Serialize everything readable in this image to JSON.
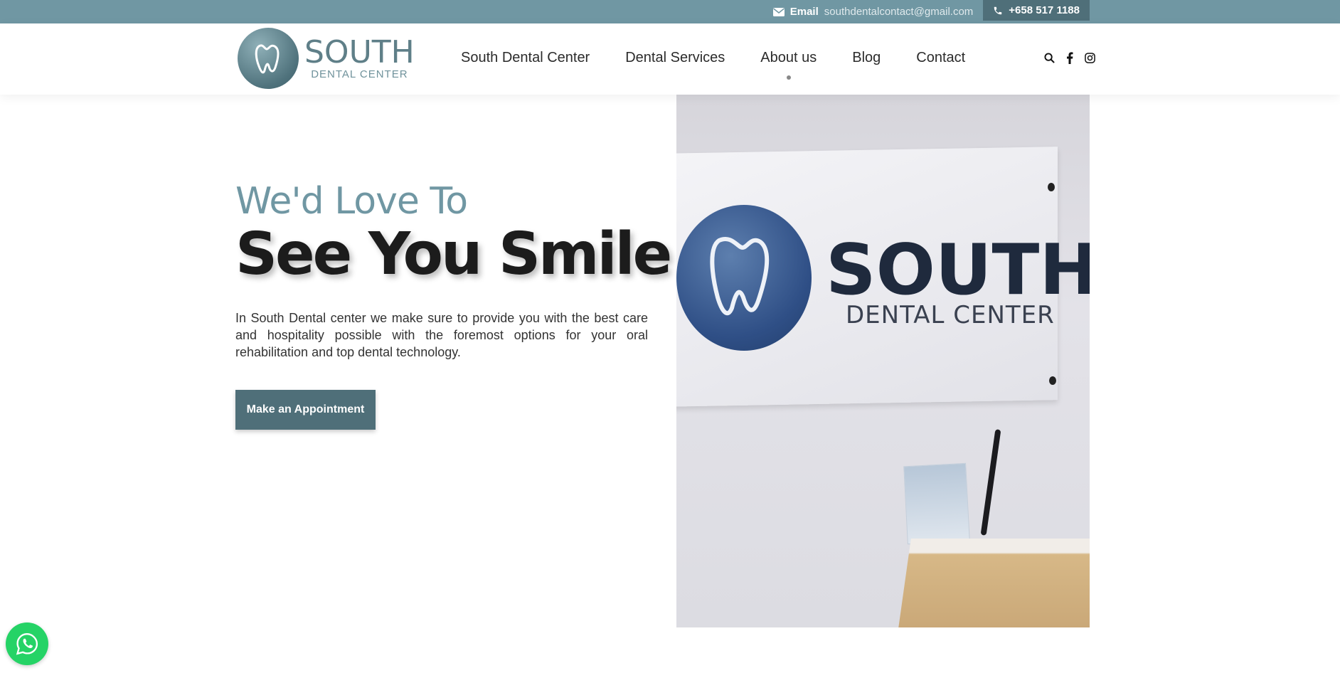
{
  "topbar": {
    "email_label": "Email",
    "email_value": "southdentalcontact@gmail.com",
    "phone": "+658 517 1188"
  },
  "logo": {
    "name": "SOUTH",
    "subtitle": "DENTAL CENTER"
  },
  "nav": {
    "items": [
      {
        "label": "South Dental Center"
      },
      {
        "label": "Dental Services"
      },
      {
        "label": "About us"
      },
      {
        "label": "Blog"
      },
      {
        "label": "Contact"
      }
    ]
  },
  "hero": {
    "subtitle": "We'd Love To",
    "title": "See You Smile",
    "description": "In South Dental center we make sure to provide you with the best care and hospitality possible with the foremost options for your oral rehabilitation and top dental technology.",
    "cta_label": "Make an Appointment"
  },
  "photo": {
    "sign_name": "SOUTH",
    "sign_subtitle": "DENTAL CENTER"
  },
  "icons": {
    "email": "envelope-icon",
    "phone": "phone-icon",
    "search": "search-icon",
    "facebook": "facebook-icon",
    "instagram": "instagram-icon",
    "whatsapp": "whatsapp-icon"
  },
  "colors": {
    "brand": "#7097a3",
    "brand_dark": "#4f6f79",
    "whatsapp": "#25d366"
  }
}
